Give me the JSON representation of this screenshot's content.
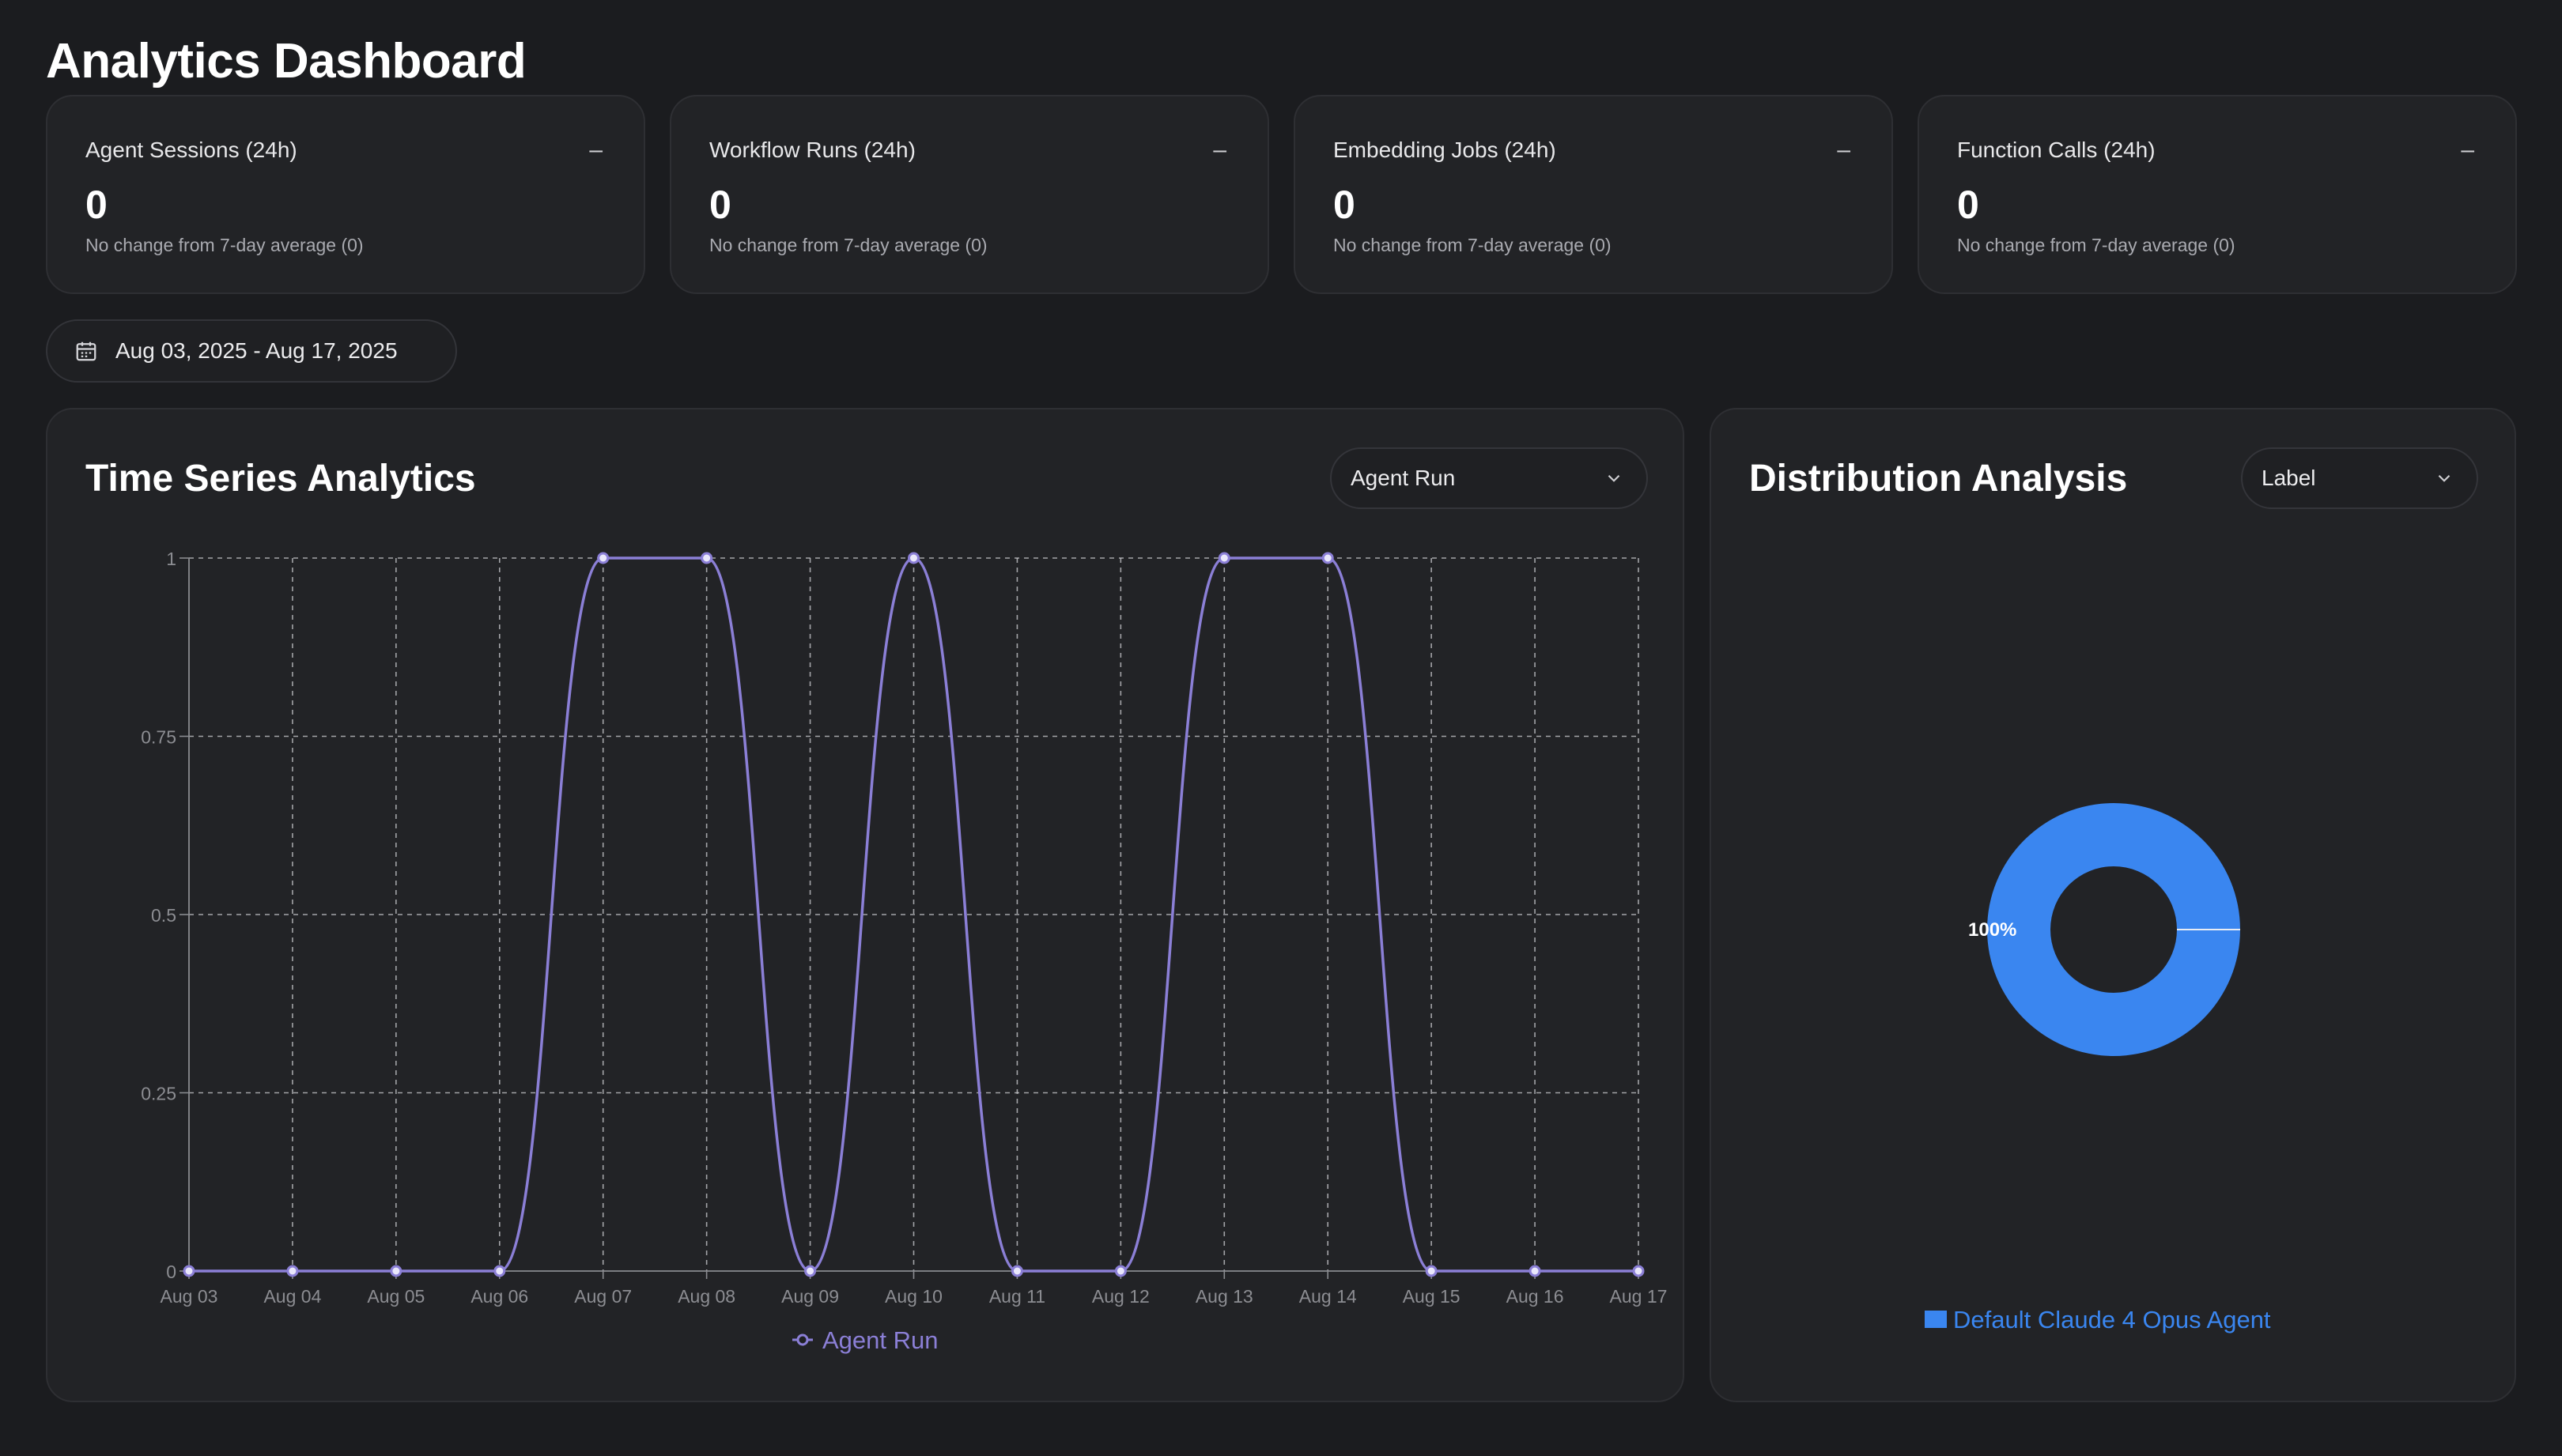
{
  "page": {
    "title": "Analytics Dashboard"
  },
  "stats": [
    {
      "title": "Agent Sessions (24h)",
      "trend": "–",
      "value": "0",
      "subtitle": "No change from 7-day average (0)"
    },
    {
      "title": "Workflow Runs (24h)",
      "trend": "–",
      "value": "0",
      "subtitle": "No change from 7-day average (0)"
    },
    {
      "title": "Embedding Jobs (24h)",
      "trend": "–",
      "value": "0",
      "subtitle": "No change from 7-day average (0)"
    },
    {
      "title": "Function Calls (24h)",
      "trend": "–",
      "value": "0",
      "subtitle": "No change from 7-day average (0)"
    }
  ],
  "date_range": {
    "label": "Aug 03, 2025 - Aug 17, 2025",
    "icon": "calendar-icon"
  },
  "time_series": {
    "title": "Time Series Analytics",
    "select_value": "Agent Run"
  },
  "distribution": {
    "title": "Distribution Analysis",
    "select_value": "Label"
  },
  "colors": {
    "line": "#8b7fd6",
    "donut": "#3a86f0",
    "legend_text": "#3a86f0"
  },
  "chart_data": [
    {
      "type": "line",
      "title": "",
      "xlabel": "",
      "ylabel": "",
      "x": [
        "Aug 03",
        "Aug 04",
        "Aug 05",
        "Aug 06",
        "Aug 07",
        "Aug 08",
        "Aug 09",
        "Aug 10",
        "Aug 11",
        "Aug 12",
        "Aug 13",
        "Aug 14",
        "Aug 15",
        "Aug 16",
        "Aug 17"
      ],
      "series": [
        {
          "name": "Agent Run",
          "values": [
            0,
            0,
            0,
            0,
            1,
            1,
            0,
            1,
            0,
            0,
            1,
            1,
            0,
            0,
            0
          ]
        }
      ],
      "ylim": [
        0,
        1
      ],
      "yticks": [
        "0",
        "0.25",
        "0.5",
        "0.75",
        "1"
      ],
      "grid": true,
      "legend": "bottom-center"
    },
    {
      "type": "pie",
      "variant": "donut",
      "slices": [
        {
          "name": "Default Claude 4 Opus Agent",
          "value": 100,
          "label": "100%"
        }
      ],
      "legend": "bottom-center"
    }
  ]
}
